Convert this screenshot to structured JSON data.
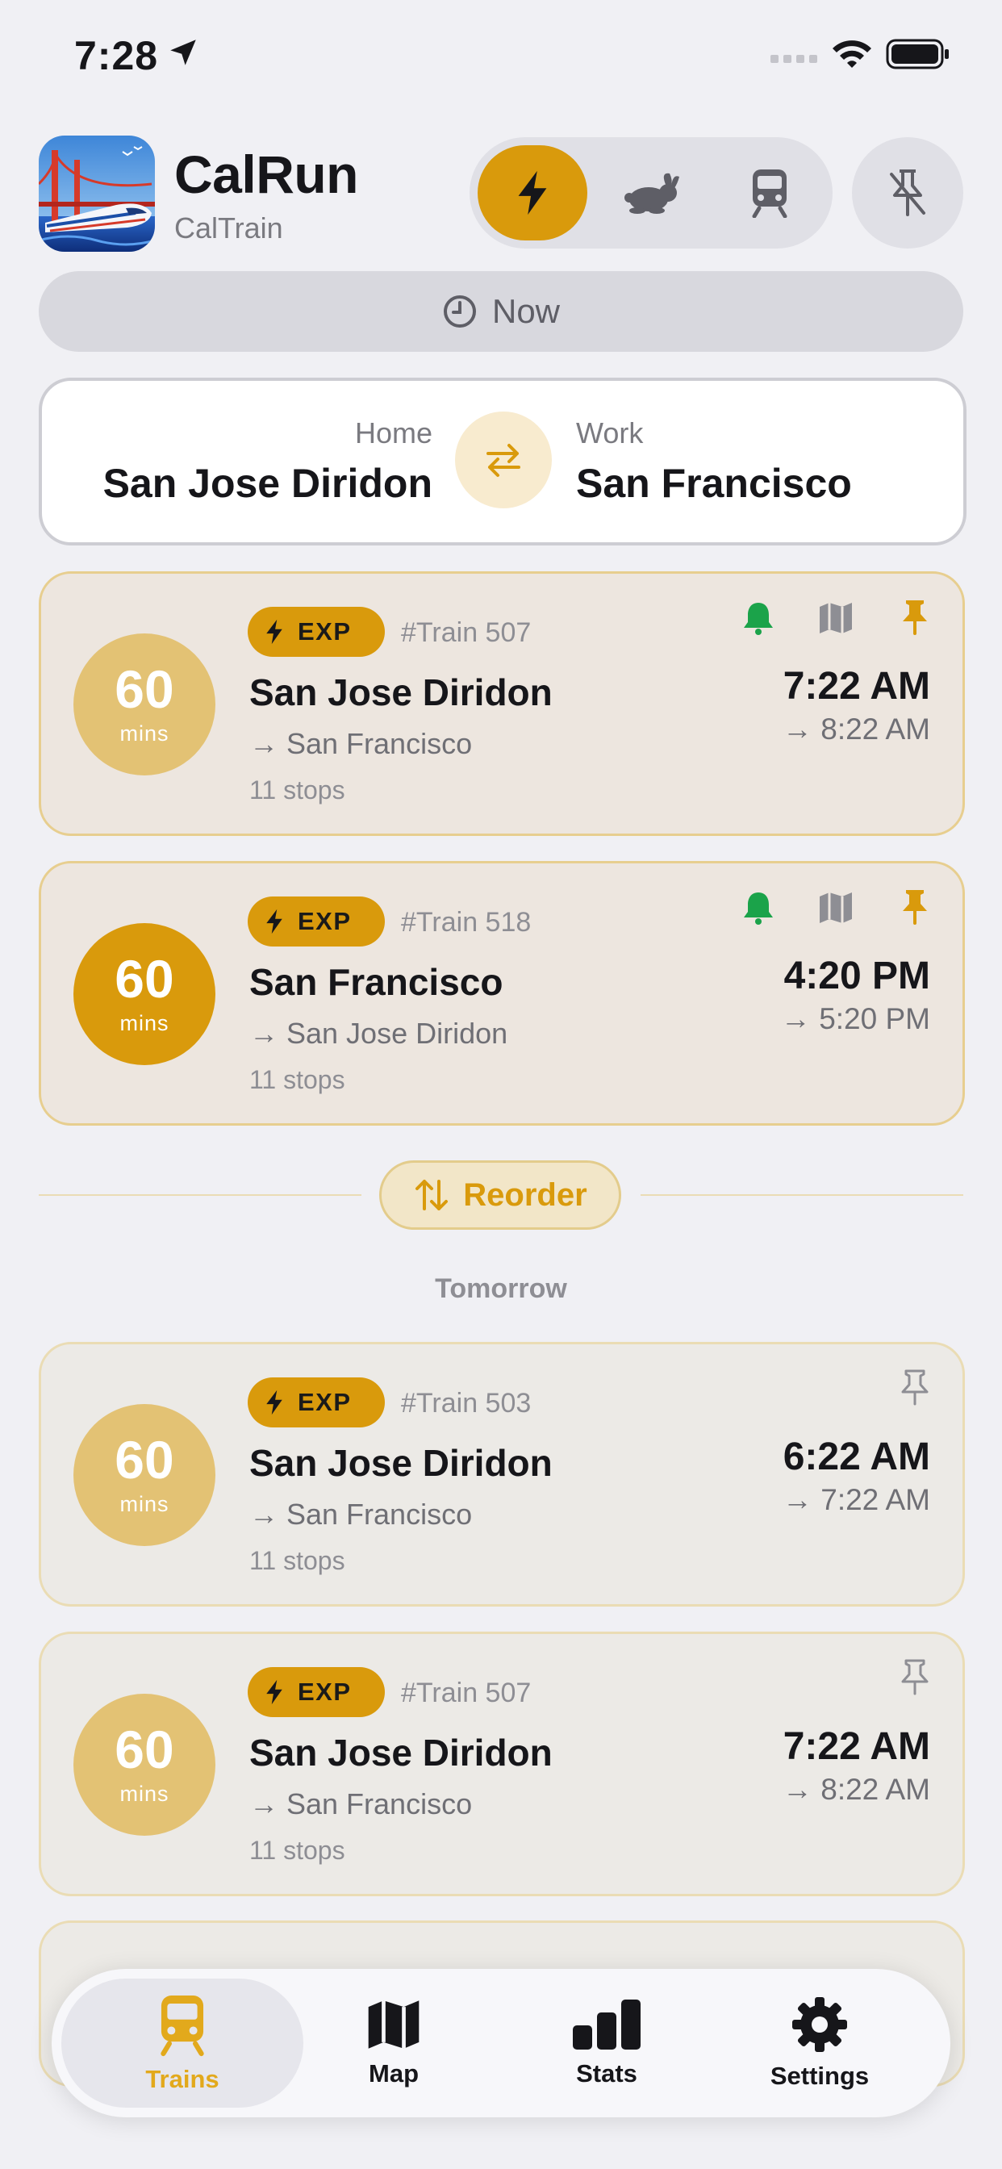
{
  "status_bar": {
    "time": "7:28"
  },
  "header": {
    "app_name": "CalRun",
    "subtitle": "CalTrain"
  },
  "mode_filter": {
    "options": [
      "express-icon",
      "rabbit-icon",
      "train-icon"
    ],
    "selected": 0
  },
  "time_button": {
    "label": "Now"
  },
  "route": {
    "from_label": "Home",
    "from_station": "San Jose Diridon",
    "to_label": "Work",
    "to_station": "San Francisco"
  },
  "pinned_trains": [
    {
      "minutes": "60",
      "mins_label": "mins",
      "badge": "EXP",
      "train_no": "#Train 507",
      "station": "San Jose Diridon",
      "destination": "→ San Francisco",
      "stops": "11 stops",
      "depart": "7:22 AM",
      "arrive": "→ 8:22 AM"
    },
    {
      "minutes": "60",
      "mins_label": "mins",
      "badge": "EXP",
      "train_no": "#Train 518",
      "station": "San Francisco",
      "destination": "→ San Jose Diridon",
      "stops": "11 stops",
      "depart": "4:20 PM",
      "arrive": "→ 5:20 PM"
    }
  ],
  "reorder": {
    "label": "Reorder"
  },
  "section_tomorrow": "Tomorrow",
  "tomorrow_trains": [
    {
      "minutes": "60",
      "mins_label": "mins",
      "badge": "EXP",
      "train_no": "#Train 503",
      "station": "San Jose Diridon",
      "destination": "→ San Francisco",
      "stops": "11 stops",
      "depart": "6:22 AM",
      "arrive": "→ 7:22 AM"
    },
    {
      "minutes": "60",
      "mins_label": "mins",
      "badge": "EXP",
      "train_no": "#Train 507",
      "station": "San Jose Diridon",
      "destination": "→ San Francisco",
      "stops": "11 stops",
      "depart": "7:22 AM",
      "arrive": "→ 8:22 AM"
    }
  ],
  "tabs": [
    {
      "label": "Trains",
      "icon": "train-icon",
      "active": true
    },
    {
      "label": "Map",
      "icon": "map-icon",
      "active": false
    },
    {
      "label": "Stats",
      "icon": "stats-icon",
      "active": false
    },
    {
      "label": "Settings",
      "icon": "gear-icon",
      "active": false
    }
  ],
  "colors": {
    "accent": "#D99A0C",
    "accent_light": "#E3C274",
    "bell_green": "#1BA34A",
    "background": "#F0F0F4"
  }
}
